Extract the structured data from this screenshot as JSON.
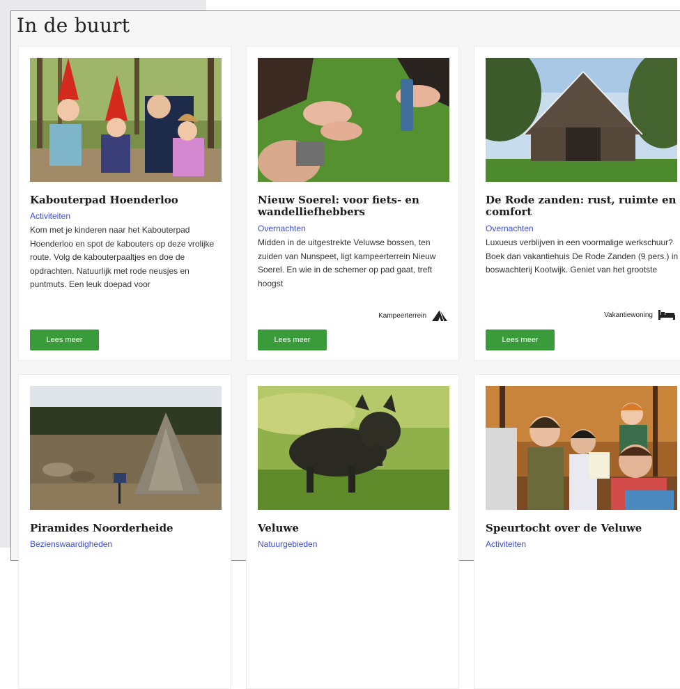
{
  "section_title": "In de buurt",
  "button_label": "Lees meer",
  "cards": [
    {
      "title": "Kabouterpad Hoenderloo",
      "category": "Activiteiten",
      "description": "Kom met je kinderen naar het Kabouterpad Hoenderloo en spot de kabouters op deze vrolijke route. Volg de kabouterpaaltjes en doe de opdrachten. Natuurlijk met rode neusjes en puntmuts. Een leuk doepad voor",
      "image": "children-with-gnome-hats-photo"
    },
    {
      "title": "Nieuw Soerel: voor fiets- en wandelliefhebbers",
      "category": "Overnachten",
      "description": "Midden in de uitgestrekte Veluwse bossen, ten zuiden van Nunspeet, ligt kampeerterrein Nieuw Soerel. En wie in de schemer op pad gaat, treft hoogst",
      "tag": "Kampeerterrein",
      "tag_icon": "tent-icon",
      "image": "hands-on-grass-photo"
    },
    {
      "title": "De Rode zanden: rust, ruimte en comfort",
      "category": "Overnachten",
      "description": "Luxueus verblijven in een voormalige werkschuur? Boek dan vakantiehuis De Rode Zanden (9 pers.) in boswachterij Kootwijk. Geniet van het grootste",
      "tag": "Vakantiewoning",
      "tag_icon": "bed-icon",
      "image": "wooden-barn-photo"
    },
    {
      "title": "Piramides Noorderheide",
      "category": "Bezienswaardigheden",
      "image": "stone-pyramid-photo"
    },
    {
      "title": "Veluwe",
      "category": "Natuurgebieden",
      "image": "wild-boar-photo"
    },
    {
      "title": "Speurtocht over de Veluwe",
      "category": "Activiteiten",
      "image": "children-in-forest-photo"
    }
  ],
  "colors": {
    "category_link": "#3b4bd2",
    "button": "#3a9b3a",
    "panel_bg": "#f6f6f6"
  }
}
